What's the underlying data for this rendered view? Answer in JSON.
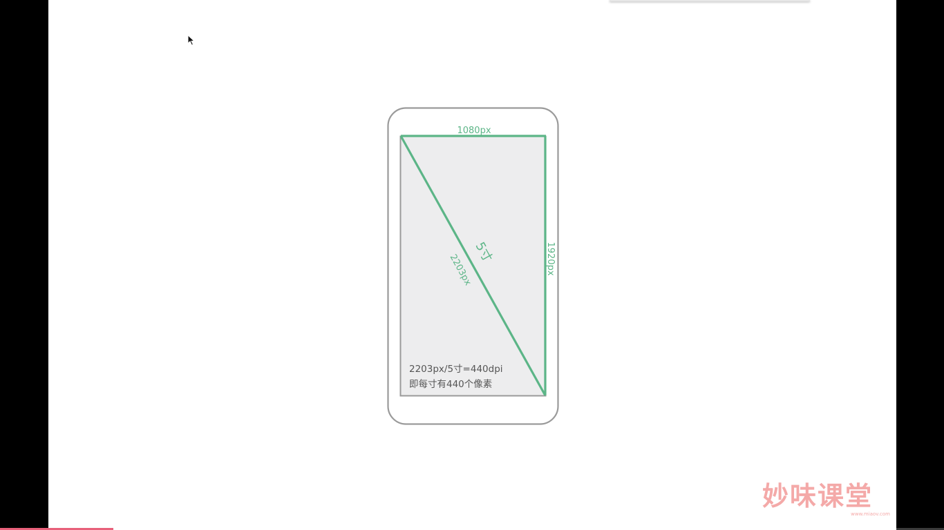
{
  "diagram": {
    "width_label": "1080px",
    "height_label": "1920px",
    "diagonal_label": "2203px",
    "size_label": "5寸",
    "formula_line": "2203px/5寸=440dpi",
    "explanation_line": "即每寸有440个像素"
  },
  "watermark": {
    "logo_text": "妙味课堂",
    "url": "www.miaov.com"
  },
  "colors": {
    "accent_green": "#5cb587",
    "phone_outline": "#9a9a9a",
    "screen_fill": "#ededee",
    "logo_pink": "#f4a9a8",
    "progress_pink": "#e8607a"
  },
  "progress": {
    "fraction": 0.12
  }
}
